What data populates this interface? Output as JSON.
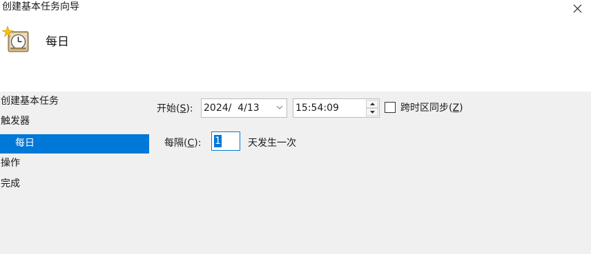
{
  "window": {
    "title": "创建基本任务向导",
    "close_icon": "close-icon"
  },
  "header": {
    "icon": "clock-icon",
    "heading": "每日"
  },
  "sidebar": {
    "steps": [
      {
        "label": "创建基本任务",
        "active": false
      },
      {
        "label": "触发器",
        "active": false
      },
      {
        "label": "每日",
        "active": true
      },
      {
        "label": "操作",
        "active": false
      },
      {
        "label": "完成",
        "active": false
      }
    ]
  },
  "form": {
    "start": {
      "label_text": "开始(",
      "label_key": "S",
      "label_tail": "):",
      "date_value": "2024/  4/13",
      "time_value": "15:54:09"
    },
    "sync": {
      "label_text": "跨时区同步(",
      "label_key": "Z",
      "label_tail": ")",
      "checked": false
    },
    "recur": {
      "label_text": "每隔(",
      "label_key": "C",
      "label_tail": "):",
      "value": "1",
      "suffix": "天发生一次"
    }
  },
  "colors": {
    "accent": "#0078d7",
    "header_bg": "#ffffff",
    "body_bg": "#f0f0f0"
  }
}
